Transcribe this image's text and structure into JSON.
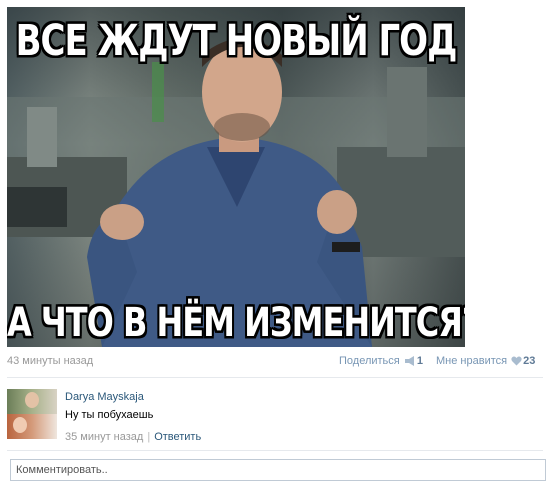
{
  "post": {
    "image": {
      "top_text": "ВСЕ ЖДУТ НОВЫЙ ГОД",
      "bottom_text": "А ЧТО В НЁМ ИЗМЕНИТСЯ?"
    },
    "time": "43 минуты назад",
    "share": {
      "label": "Поделиться",
      "count": "1",
      "icon": "megaphone-icon"
    },
    "like": {
      "label": "Мне нравится",
      "count": "23",
      "icon": "heart-icon"
    }
  },
  "comment": {
    "author": "Darya Mayskaja",
    "text": "Ну ты побухаешь",
    "time": "35 минут назад",
    "reply_label": "Ответить"
  },
  "reply_input": {
    "placeholder": "Комментировать.."
  },
  "colors": {
    "link": "#2b587a",
    "action": "#7896b4",
    "muted": "#999999",
    "border": "#c0cad5"
  }
}
